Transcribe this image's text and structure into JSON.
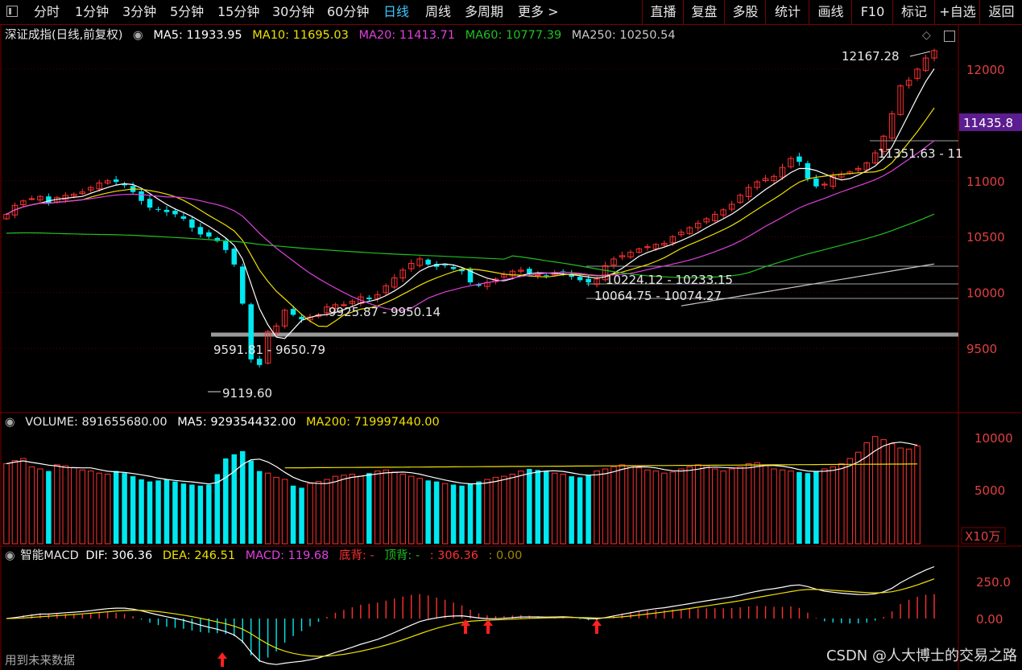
{
  "toolbar": {
    "left": [
      "分时",
      "1分钟",
      "3分钟",
      "5分钟",
      "15分钟",
      "30分钟",
      "60分钟",
      "日线",
      "周线",
      "多周期",
      "更多 >"
    ],
    "active": "日线",
    "right": [
      "直播",
      "复盘",
      "多股",
      "统计",
      "画线",
      "F10",
      "标记",
      "+自选",
      "返回"
    ]
  },
  "main_header": {
    "title": "深证成指(日线,前复权)",
    "ma5": "MA5: 11933.95",
    "ma10": "MA10: 11695.03",
    "ma20": "MA20: 11413.71",
    "ma60": "MA60: 10777.39",
    "ma250": "MA250: 10250.54"
  },
  "volume_header": {
    "volume": "VOLUME: 891655680.00",
    "ma5": "MA5: 929354432.00",
    "ma200": "MA200: 719997440.00"
  },
  "macd_header": {
    "title": "智能MACD",
    "dif": "DIF: 306.36",
    "dea": "DEA: 246.51",
    "macd": "MACD: 119.68",
    "bottom_div": "底背: -",
    "top_div": "顶背: -",
    "val1": ": 306.36",
    "val2": ": 0.00"
  },
  "colors": {
    "up": "#ff3030",
    "down": "#00e8f0",
    "ma5": "#ffffff",
    "ma10": "#f0e000",
    "ma20": "#e040e0",
    "ma60": "#20c020",
    "ma250": "#c8c8c8",
    "frame": "#7a0000"
  },
  "price_axis": {
    "ticks": [
      "12000",
      "11000",
      "10500",
      "10000",
      "9500"
    ],
    "current_price": "11435.8"
  },
  "volume_axis": {
    "ticks": [
      "10000",
      "5000"
    ],
    "unit": "X10万"
  },
  "macd_axis": {
    "ticks": [
      "250.0",
      "0.00"
    ]
  },
  "annotations": {
    "high": "12167.28",
    "low": "9119.60",
    "range_a": "9591.81 - 9650.79",
    "range_b": "9925.87 - 9950.14",
    "range_c": "10224.12 - 10233.15",
    "range_d": "10064.75 - 10074.27",
    "range_e": "11351.63 - 11"
  },
  "footer": {
    "future_label": "用到未来数据",
    "watermark": "CSDN @人大博士的交易之路"
  },
  "chart_data": {
    "type": "candlestick",
    "title": "深证成指(日线,前复权)",
    "price_ylim": [
      9000,
      12300
    ],
    "close": [
      10700,
      10780,
      10820,
      10840,
      10860,
      10800,
      10850,
      10870,
      10880,
      10900,
      10940,
      10980,
      11000,
      10990,
      10960,
      10900,
      10820,
      10760,
      10740,
      10720,
      10700,
      10660,
      10580,
      10520,
      10500,
      10460,
      10380,
      10250,
      9900,
      9400,
      9350,
      9650,
      9700,
      9840,
      9800,
      9760,
      9780,
      9800,
      9870,
      9890,
      9890,
      9920,
      9960,
      9940,
      9980,
      10060,
      10130,
      10200,
      10260,
      10300,
      10250,
      10230,
      10240,
      10210,
      10190,
      10090,
      10060,
      10090,
      10120,
      10160,
      10190,
      10200,
      10170,
      10160,
      10150,
      10170,
      10180,
      10140,
      10110,
      10090,
      10120,
      10240,
      10300,
      10330,
      10360,
      10390,
      10410,
      10430,
      10440,
      10500,
      10540,
      10580,
      10620,
      10660,
      10700,
      10740,
      10790,
      10870,
      10940,
      10990,
      11020,
      11040,
      11120,
      11200,
      11170,
      11020,
      10950,
      10970,
      11040,
      11060,
      11080,
      11110,
      11160,
      11250,
      11400,
      11600,
      11850,
      11900,
      12000,
      12100,
      12167
    ],
    "volume_series": [
      7.5,
      7.8,
      8.0,
      7.2,
      7.0,
      6.8,
      7.4,
      7.3,
      7.1,
      6.9,
      6.8,
      6.6,
      6.5,
      6.8,
      6.6,
      6.3,
      6.0,
      5.8,
      5.9,
      6.0,
      5.8,
      5.6,
      5.5,
      5.4,
      5.5,
      6.5,
      8.0,
      8.4,
      8.7,
      7.8,
      6.8,
      6.6,
      6.2,
      6.0,
      5.4,
      5.2,
      5.6,
      5.8,
      6.0,
      6.3,
      6.4,
      6.5,
      6.3,
      6.6,
      6.8,
      6.9,
      6.7,
      6.5,
      6.3,
      6.1,
      5.9,
      5.8,
      5.6,
      5.5,
      5.4,
      5.6,
      5.8,
      6.0,
      6.2,
      6.3,
      6.5,
      6.8,
      7.0,
      6.9,
      6.8,
      6.6,
      6.5,
      6.3,
      6.2,
      6.4,
      6.8,
      7.0,
      7.2,
      7.4,
      7.3,
      7.1,
      6.9,
      6.8,
      6.6,
      6.7,
      7.0,
      7.2,
      7.4,
      7.3,
      7.0,
      6.8,
      7.0,
      7.2,
      7.5,
      7.6,
      7.3,
      7.0,
      6.9,
      6.8,
      6.7,
      6.6,
      6.8,
      7.0,
      7.2,
      7.5,
      8.0,
      8.6,
      9.5,
      10.1,
      9.8,
      9.4,
      9.0,
      8.9,
      9.2
    ],
    "ma_labels": [
      "MA5",
      "MA10",
      "MA20",
      "MA60",
      "MA250"
    ]
  }
}
